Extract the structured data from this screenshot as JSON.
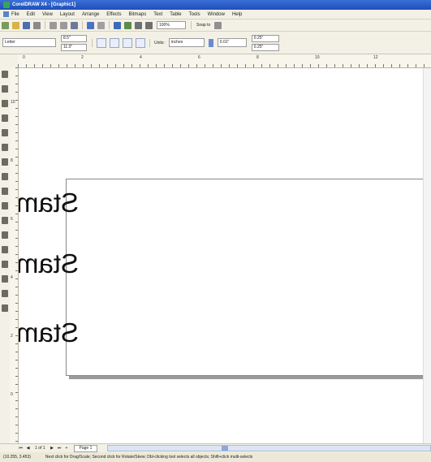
{
  "window": {
    "title": "CorelDRAW X4 - [Graphic1]"
  },
  "menu": [
    "File",
    "Edit",
    "View",
    "Layout",
    "Arrange",
    "Effects",
    "Bitmaps",
    "Text",
    "Table",
    "Tools",
    "Window",
    "Help"
  ],
  "toolbar": {
    "zoom_value": "100%",
    "snap_label": "Snap to"
  },
  "property_bar": {
    "paper_type": "Letter",
    "width": "8.5\"",
    "height": "11.0\"",
    "units_label": "Units:",
    "units_value": "inches",
    "nudge_value": "0.01\"",
    "dup_x": "0.25\"",
    "dup_y": "0.25\""
  },
  "ruler": {
    "h_ticks": [
      "0",
      "2",
      "4",
      "6",
      "8",
      "10",
      "12"
    ],
    "v_ticks": [
      "10",
      "8",
      "6",
      "4",
      "2",
      "0"
    ]
  },
  "canvas": {
    "line1": "Stamps!",
    "line2": "Stamps! Stamps!",
    "line3": "Stamps! Stamps! Stamps!"
  },
  "page_nav": {
    "page_count": "1 of 1",
    "page_tab": "Page 1"
  },
  "status": {
    "coords": "(10.255, 3.453)",
    "hint": "Next click for Drag/Scale; Second click for Rotate/Skew; Dbl-clicking tool selects all objects; Shift+click multi-selects"
  }
}
